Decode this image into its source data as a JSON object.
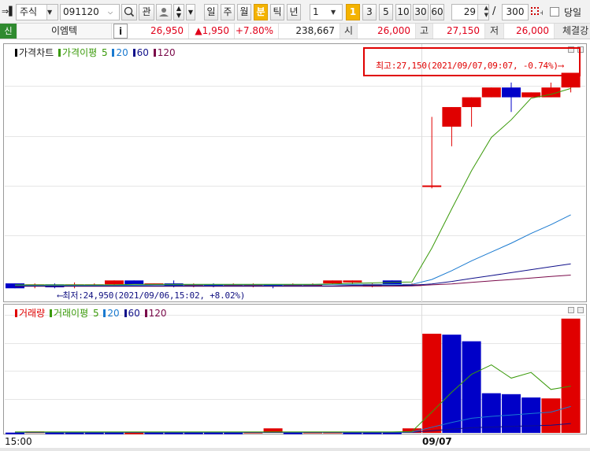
{
  "toolbar": {
    "market": "주식",
    "code": "091120",
    "search_icon": "magnifier-icon",
    "gwan_label": "관",
    "periods": [
      "일",
      "주",
      "월",
      "분",
      "틱",
      "년"
    ],
    "period_selected": "분",
    "interval_value": "1",
    "minute_buttons": [
      "1",
      "3",
      "5",
      "10",
      "30",
      "60"
    ],
    "minute_selected": "1",
    "page_current": "29",
    "page_separator": "/",
    "page_total": "300",
    "today_label": "당일",
    "today_checked": false
  },
  "quote": {
    "new_badge": "신",
    "name": "이엠텍",
    "info_button": "i",
    "price": "26,950",
    "change": "▲1,950",
    "change_pct": "+7.80%",
    "volume": "238,667",
    "open_label": "시",
    "open": "26,000",
    "high_label": "고",
    "high": "27,150",
    "low_label": "저",
    "low": "26,000",
    "strength_label": "체결강"
  },
  "price_panel": {
    "legend_title": "가격차트",
    "ma_title": "가격이평",
    "ma_periods": [
      "5",
      "20",
      "60",
      "120"
    ],
    "high_annotation": "최고:27,150(2021/09/07,09:07, -0.74%)⟶",
    "low_annotation": "⟵최저:24,950(2021/09/06,15:02, +8.02%)"
  },
  "volume_panel": {
    "legend_title": "거래량",
    "ma_title": "거래이평",
    "ma_periods": [
      "5",
      "20",
      "60",
      "120"
    ]
  },
  "colors": {
    "up": "#e00000",
    "down": "#0000c8",
    "ma5": "#3a9a0a",
    "ma20": "#1a7ad0",
    "ma60": "#10108a",
    "ma120": "#7a0a4a",
    "highlight_border": "#e00000",
    "selected_button": "#f4b300"
  },
  "x_axis": {
    "labels": [
      "15:00",
      "09/07"
    ]
  },
  "chart_data": [
    {
      "type": "candlestick",
      "title": "가격차트",
      "x": [
        "09/06 15:00",
        "",
        "",
        "",
        "",
        "",
        "",
        "",
        "",
        "",
        "",
        "",
        "",
        "",
        "",
        "",
        "",
        "",
        "",
        "",
        "",
        "09/07 09:01",
        "09/07 09:02",
        "09/07 09:03",
        "09/07 09:04",
        "09/07 09:05",
        "09/07 09:06",
        "09/07 09:07",
        "09/07 09:08"
      ],
      "ohlc": [
        [
          25000,
          25000,
          24950,
          24950
        ],
        [
          24980,
          25000,
          24950,
          24990
        ],
        [
          24990,
          25000,
          24950,
          24960
        ],
        [
          24970,
          25010,
          24950,
          24990
        ],
        [
          24990,
          25000,
          24980,
          24990
        ],
        [
          24990,
          25030,
          24980,
          25030
        ],
        [
          25030,
          25030,
          24990,
          24990
        ],
        [
          24990,
          25000,
          24990,
          25000
        ],
        [
          25000,
          25030,
          24960,
          24970
        ],
        [
          24970,
          25000,
          24960,
          24990
        ],
        [
          24990,
          25000,
          24960,
          24980
        ],
        [
          24990,
          25000,
          24980,
          24990
        ],
        [
          24990,
          25000,
          24960,
          24990
        ],
        [
          24990,
          24990,
          24950,
          24980
        ],
        [
          24990,
          25000,
          24970,
          24990
        ],
        [
          24990,
          25000,
          24970,
          24990
        ],
        [
          25000,
          25030,
          24990,
          25030
        ],
        [
          25010,
          25030,
          24990,
          25030
        ],
        [
          24990,
          25000,
          24960,
          24990
        ],
        [
          25030,
          25030,
          24990,
          24990
        ],
        [
          24990,
          25000,
          24990,
          24990
        ],
        [
          26000,
          26700,
          25970,
          26000
        ],
        [
          26600,
          26800,
          26400,
          26800
        ],
        [
          26800,
          26900,
          26600,
          26900
        ],
        [
          26900,
          27000,
          26900,
          27000
        ],
        [
          27000,
          27050,
          26750,
          26900
        ],
        [
          26900,
          26950,
          26900,
          26950
        ],
        [
          26900,
          27050,
          26900,
          27000
        ],
        [
          27000,
          27150,
          26950,
          27150
        ]
      ],
      "ma": {
        "5": [
          24985,
          24985,
          24985,
          24985,
          24985,
          24985,
          24990,
          24990,
          24990,
          24990,
          24990,
          24990,
          24990,
          24990,
          24990,
          24990,
          24995,
          25000,
          25005,
          25010,
          25015,
          25360,
          25760,
          26150,
          26490,
          26670,
          26890,
          26930,
          26990
        ],
        "20": [
          24980,
          24980,
          24980,
          24980,
          24980,
          24980,
          24980,
          24985,
          24985,
          24985,
          24985,
          24985,
          24985,
          24985,
          24985,
          24985,
          24990,
          24990,
          24990,
          24990,
          24990,
          25040,
          25130,
          25230,
          25320,
          25410,
          25510,
          25600,
          25700
        ],
        "60": [
          24975,
          24975,
          24975,
          24975,
          24975,
          24975,
          24975,
          24975,
          24975,
          24975,
          24975,
          24975,
          24975,
          24975,
          24975,
          24975,
          24975,
          24980,
          24980,
          24980,
          24980,
          24995,
          25020,
          25050,
          25080,
          25110,
          25140,
          25170,
          25200
        ],
        "120": [
          24970,
          24970,
          24970,
          24970,
          24970,
          24970,
          24970,
          24970,
          24970,
          24970,
          24970,
          24970,
          24970,
          24970,
          24970,
          24970,
          24970,
          24970,
          24970,
          24970,
          24975,
          24985,
          24995,
          25010,
          25025,
          25040,
          25055,
          25070,
          25085
        ]
      },
      "high": {
        "value": 27150,
        "time": "2021/09/07,09:07",
        "pct": "-0.74%"
      },
      "low": {
        "value": 24950,
        "time": "2021/09/06,15:02",
        "pct": "+8.02%"
      }
    },
    {
      "type": "bar",
      "title": "거래량",
      "values": [
        300,
        1500,
        300,
        300,
        300,
        300,
        300,
        300,
        300,
        300,
        300,
        300,
        1200,
        4800,
        300,
        1200,
        1200,
        300,
        300,
        300,
        4800,
        105000,
        104000,
        97000,
        42000,
        41000,
        37500,
        36500,
        121000
      ],
      "directions": [
        "down",
        "up",
        "down",
        "down",
        "down",
        "down",
        "up",
        "down",
        "down",
        "down",
        "down",
        "down",
        "up",
        "up",
        "down",
        "up",
        "up",
        "down",
        "down",
        "down",
        "up",
        "up",
        "down",
        "down",
        "down",
        "down",
        "down",
        "up",
        "up"
      ],
      "ma": {
        "5": [
          1000,
          1000,
          1000,
          1000,
          1000,
          1000,
          1000,
          1000,
          1000,
          1000,
          1000,
          1000,
          1000,
          1000,
          1000,
          1000,
          1000,
          1000,
          1000,
          1000,
          1500,
          22000,
          43000,
          62000,
          72000,
          58000,
          64000,
          46000,
          49500
        ],
        "20": [
          800,
          800,
          800,
          800,
          800,
          800,
          800,
          800,
          800,
          800,
          800,
          800,
          800,
          800,
          800,
          800,
          800,
          800,
          800,
          800,
          900,
          6000,
          11000,
          15500,
          17500,
          19000,
          20500,
          22000,
          28000
        ],
        "60": [
          500,
          500,
          500,
          500,
          500,
          500,
          500,
          500,
          500,
          500,
          500,
          500,
          500,
          500,
          500,
          500,
          500,
          500,
          500,
          500,
          550,
          2300,
          4000,
          5500,
          6200,
          6900,
          7500,
          8100,
          9900
        ]
      },
      "ylim": [
        0,
        125000
      ]
    }
  ]
}
